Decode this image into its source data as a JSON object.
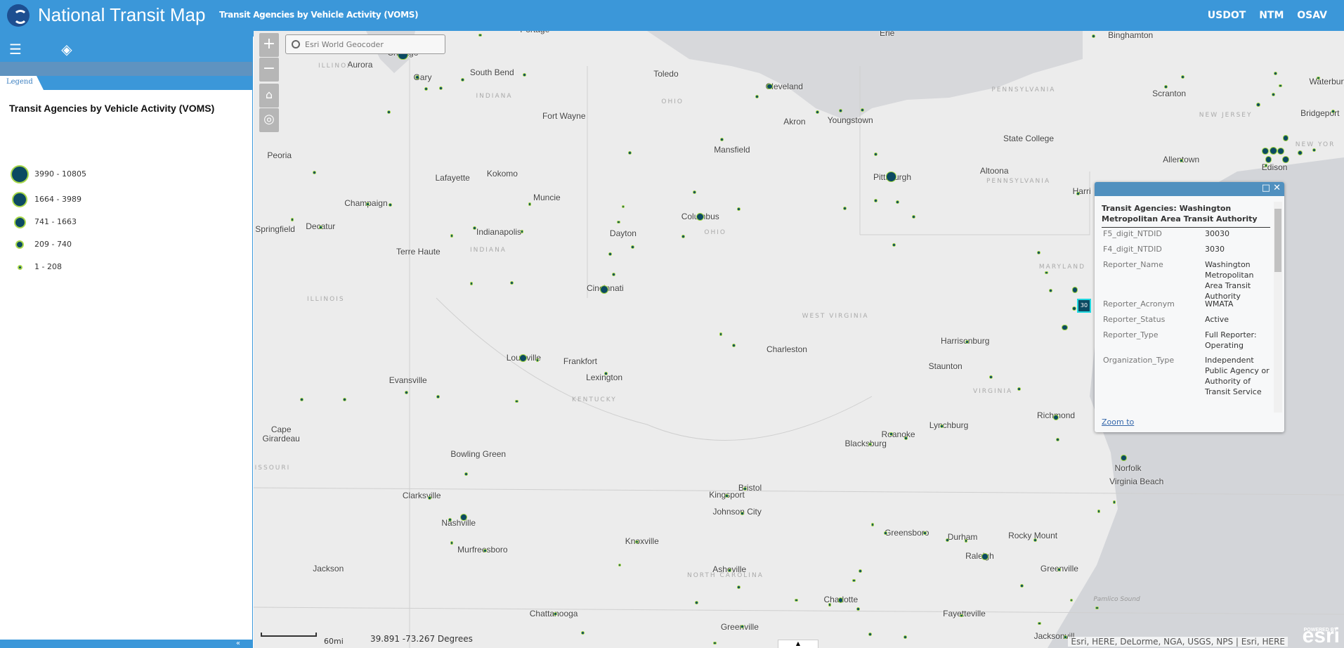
{
  "header": {
    "title": "National Transit Map",
    "subtitle": "Transit Agencies by Vehicle Activity (VOMS)",
    "links": [
      "USDOT",
      "NTM",
      "OSAV"
    ]
  },
  "sidebar": {
    "tab": "Legend",
    "legend_title": "Transit Agencies by Vehicle Activity (VOMS)",
    "legend_items": [
      {
        "label": "3990 - 10805"
      },
      {
        "label": "1664 - 3989"
      },
      {
        "label": "741 - 1663"
      },
      {
        "label": "209 - 740"
      },
      {
        "label": "1 - 208"
      }
    ],
    "collapse_icon": "«"
  },
  "map": {
    "search_placeholder": "Esri World Geocoder",
    "zoom_in": "+",
    "zoom_out": "−",
    "scale": "60mi",
    "coords": "39.891  -73.267 Degrees",
    "attribution": "Esri, HERE, DeLorme, NGA, USGS, NPS | Esri, HERE",
    "esri_logo": "esri",
    "esri_powered": "POWERED BY",
    "cities": [
      "Portage",
      "Erie",
      "Binghamton",
      "Aurora",
      "South Bend",
      "Toledo",
      "Cleveland",
      "Gary",
      "Waterbury",
      "Scranton",
      "Fort Wayne",
      "Akron",
      "Youngstown",
      "Bridgeport",
      "State College",
      "Mansfield",
      "Peoria",
      "Allentown",
      "Edison",
      "Pittsburgh",
      "Altoona",
      "Lafayette",
      "Kokomo",
      "Muncie",
      "Harri",
      "Champaign",
      "Columbus",
      "Springfield",
      "Decatur",
      "Indianapolis",
      "Dayton",
      "Terre Haute",
      "Cincinnati",
      "Charleston",
      "Harrisonburg",
      "Louisville",
      "Frankfort",
      "Lexington",
      "Staunton",
      "Evansville",
      "Richmond",
      "Cape Girardeau",
      "Lynchburg",
      "Roanoke",
      "Blacksburg",
      "Bowling Green",
      "Norfolk",
      "Virginia Beach",
      "Bristol",
      "Clarksville",
      "Kingsport",
      "Johnson City",
      "Nashville",
      "Greensboro",
      "Durham",
      "Raleigh",
      "Rocky Mount",
      "Murfreesboro",
      "Knoxville",
      "Jackson",
      "Asheville",
      "Greenville",
      "Charlotte",
      "Fayetteville",
      "Chattanooga",
      "Greenville",
      "Jacksonvill",
      "Chicago"
    ],
    "states": [
      "INDIANA",
      "OHIO",
      "PENNSYLVANIA",
      "PENNSYLVANIA",
      "NEW JERSEY",
      "INDIANA",
      "OHIO",
      "ILLINOIS",
      "ILLINOI",
      "MARYLAND",
      "WEST VIRGINIA",
      "VIRGINIA",
      "KENTUCKY",
      "MISSOURI",
      "NORTH CAROLINA",
      "Pamlico Sound",
      "NEW YOR"
    ]
  },
  "popup": {
    "title": "Transit Agencies: Washington Metropolitan Area Transit Authority",
    "zoom_to": "Zoom to",
    "selected_marker": "30",
    "fields": [
      {
        "key": "F5_digit_NTDID",
        "value": "30030"
      },
      {
        "key": "F4_digit_NTDID",
        "value": "3030"
      },
      {
        "key": "Reporter_Name",
        "value": "Washington Metropolitan Area Transit Authority"
      },
      {
        "key": "Reporter_Acronym",
        "value": "WMATA"
      },
      {
        "key": "Reporter_Status",
        "value": "Active"
      },
      {
        "key": "Reporter_Type",
        "value": "Full Reporter: Operating"
      },
      {
        "key": "Organization_Type",
        "value": "Independent Public Agency or Authority of Transit Service"
      }
    ]
  },
  "colors": {
    "header": "#3b97d9",
    "marker_fill": "#0c4a62",
    "marker_stroke": "#9ed33f"
  }
}
